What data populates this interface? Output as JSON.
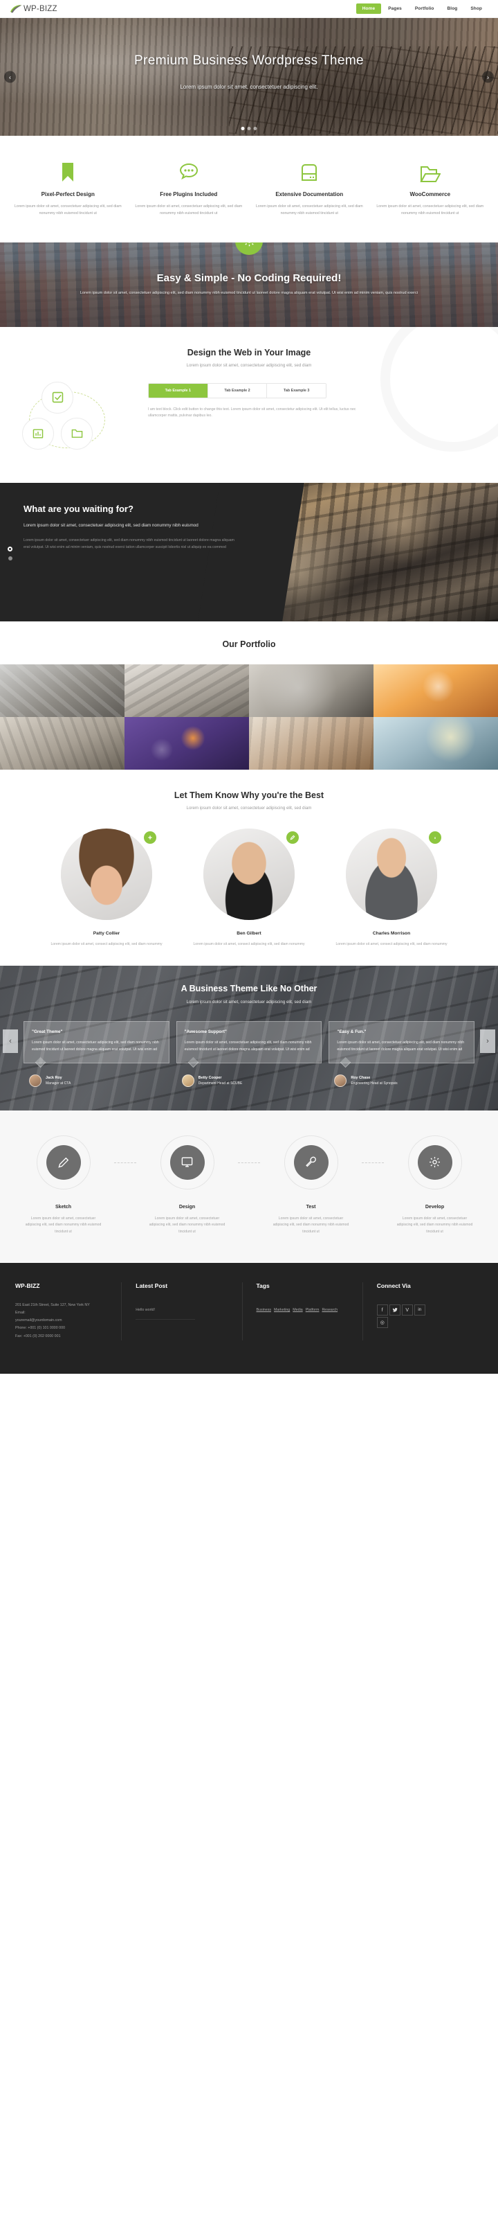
{
  "brand": {
    "name": "WP-BIZZ",
    "accent": "#8dc63f"
  },
  "nav": {
    "items": [
      {
        "label": "Home",
        "active": true
      },
      {
        "label": "Pages",
        "active": false
      },
      {
        "label": "Portfolio",
        "active": false
      },
      {
        "label": "Blog",
        "active": false
      },
      {
        "label": "Shop",
        "active": false
      }
    ]
  },
  "hero": {
    "title": "Premium Business Wordpress Theme",
    "subtitle": "Lorem ipsum dolor sit amet, consectetuer adipiscing elit.",
    "prev": "‹",
    "next": "›"
  },
  "features": [
    {
      "icon": "bookmark-icon",
      "title": "Pixel-Perfect Design",
      "text": "Lorem ipsum dolor sit amet, consectetuer adipiscing elit, sed diam nonummy nibh euismod tincidunt ut"
    },
    {
      "icon": "chat-bubble-icon",
      "title": "Free Plugins Included",
      "text": "Lorem ipsum dolor sit amet, consectetuer adipiscing elit, sed diam nonummy nibh euismod tincidunt ut"
    },
    {
      "icon": "documentation-icon",
      "title": "Extensive Documentation",
      "text": "Lorem ipsum dolor sit amet, consectetuer adipiscing elit, sed diam nonummy nibh euismod tincidunt ut"
    },
    {
      "icon": "folder-icon",
      "title": "WooCommerce",
      "text": "Lorem ipsum dolor sit amet, consectetuer adipiscing elit, sed diam nonummy nibh euismod tincidunt ut"
    }
  ],
  "parallax": {
    "icon": "gear-icon",
    "title": "Easy & Simple - No Coding Required!",
    "text": "Lorem ipsum dolor sit amet, consectetuer adipiscing elit, sed diam nonummy nibh euismod tincidunt ut laoreet dolore magna aliquam erat volutpat. Ut wisi enim ad minim veniam, quis nostrud exerci"
  },
  "tabs_section": {
    "title": "Design the Web in Your Image",
    "subtitle": "Lorem ipsum dolor sit amet, consectetuer adipiscing elit, sed diam",
    "tabs": [
      {
        "label": "Tab Example 1",
        "active": true
      },
      {
        "label": "Tab Example 2",
        "active": false
      },
      {
        "label": "Tab Example 3",
        "active": false
      }
    ],
    "content": "I am text block. Click edit button to change this text. Lorem ipsum dolor sit amet, consectetur adipiscing elit. Ut elit tellus, luctus nec ullamcorper mattis, pulvinar dapibus leo.",
    "circle_icons": [
      "check-square-icon",
      "bar-chart-icon",
      "folder-icon"
    ]
  },
  "dark_section": {
    "title": "What are you waiting for?",
    "lead": "Lorem ipsum dolor sit amet, consectetuer adipiscing elit, sed diam nonummy nibh euismod",
    "body": "Lorem ipsum dolor sit amet, consectetuer adipiscing elit, sed diam nonummy nibh euismod tincidunt ut laoreet dolore magna aliquam erat volutpat. Ut wisi enim ad minim veniam, quis nostrud exerci tation ullamcorper suscipit lobortis nisl ut aliquip ex ea commod"
  },
  "portfolio": {
    "title": "Our Portfolio",
    "item_count": 8
  },
  "team": {
    "title": "Let Them Know Why you're the Best",
    "subtitle": "Lorem ipsum dolor sit amet, consectetuer adipiscing elit, sed diam",
    "members": [
      {
        "name": "Patty Collier",
        "text": "Lorem ipsum dolor sit amet, consect adipiscing elit, sed diam nonummy",
        "badge": "plus-icon"
      },
      {
        "name": "Ben Gilbert",
        "text": "Lorem ipsum dolor sit amet, consect adipiscing elit, sed diam nonummy",
        "badge": "pencil-icon"
      },
      {
        "name": "Charles Morrison",
        "text": "Lorem ipsum dolor sit amet, consect adipiscing elit, sed diam nonummy",
        "badge": "info-icon"
      }
    ]
  },
  "testimonials": {
    "title": "A Business Theme Like No Other",
    "subtitle": "Lorem ipsum dolor sit amet, consectetuer adipiscing elit, sed diam",
    "prev": "‹",
    "next": "›",
    "items": [
      {
        "quote": "\"Great Theme\"",
        "text": "Lorem ipsum dolor sit amet, consectetuer adipiscing elit, sed diam nonummy nibh euismod tincidunt ut laoreet dolore magna aliquam erat volutpat. Ut wisi enim ad",
        "name": "Jack Roy",
        "role": "Manager at CTA"
      },
      {
        "quote": "\"Awesome Support\"",
        "text": "Lorem ipsum dolor sit amet, consectetuer adipiscing elit, sed diam nonummy nibh euismod tincidunt ut laoreet dolore magna aliquam erat volutpat. Ut wisi enim ad",
        "name": "Betty Cooper",
        "role": "Department Head at SCUBE"
      },
      {
        "quote": "\"Easy & Fun.\"",
        "text": "Lorem ipsum dolor sit amet, consectetuer adipiscing elit, sed diam nonummy nibh euismod tincidunt ut laoreet dolore magna aliquam erat volutpat. Ut wisi enim ad",
        "name": "Roy Chase",
        "role": "Engineering Head at Synopsis"
      }
    ]
  },
  "process": {
    "steps": [
      {
        "icon": "pencil-icon",
        "title": "Sketch",
        "text": "Lorem ipsum dolor sit amet, consectetuer adipiscing elit, sed diam nonummy nibh euismod tincidunt ut"
      },
      {
        "icon": "monitor-icon",
        "title": "Design",
        "text": "Lorem ipsum dolor sit amet, consectetuer adipiscing elit, sed diam nonummy nibh euismod tincidunt ut"
      },
      {
        "icon": "wrench-icon",
        "title": "Test",
        "text": "Lorem ipsum dolor sit amet, consectetuer adipiscing elit, sed diam nonummy nibh euismod tincidunt ut"
      },
      {
        "icon": "gear-icon",
        "title": "Develop",
        "text": "Lorem ipsum dolor sit amet, consectetuer adipiscing elit, sed diam nonummy nibh euismod tincidunt ut"
      }
    ]
  },
  "footer": {
    "about": {
      "title": "WP-BIZZ",
      "address": "201 East 21th Street, Suite 127, New York NY",
      "email_label": "Email:",
      "email": "youremail@yourdomain.com",
      "phone": "Phone: +001 (0) 101 0000 000",
      "fax": "Fax: +001 (0) 202 0000 001"
    },
    "latest_post": {
      "title": "Latest Post",
      "item": "Hello world!"
    },
    "tags": {
      "title": "Tags",
      "items": [
        "Business",
        "Marketing",
        "Media",
        "Platform",
        "Research"
      ]
    },
    "connect": {
      "title": "Connect Via",
      "socials": [
        {
          "name": "facebook-icon",
          "glyph": "f"
        },
        {
          "name": "twitter-icon",
          "glyph": "ᵛ"
        },
        {
          "name": "vimeo-icon",
          "glyph": "V"
        },
        {
          "name": "linkedin-icon",
          "glyph": "in"
        },
        {
          "name": "instagram-icon",
          "glyph": "◎"
        }
      ]
    }
  }
}
